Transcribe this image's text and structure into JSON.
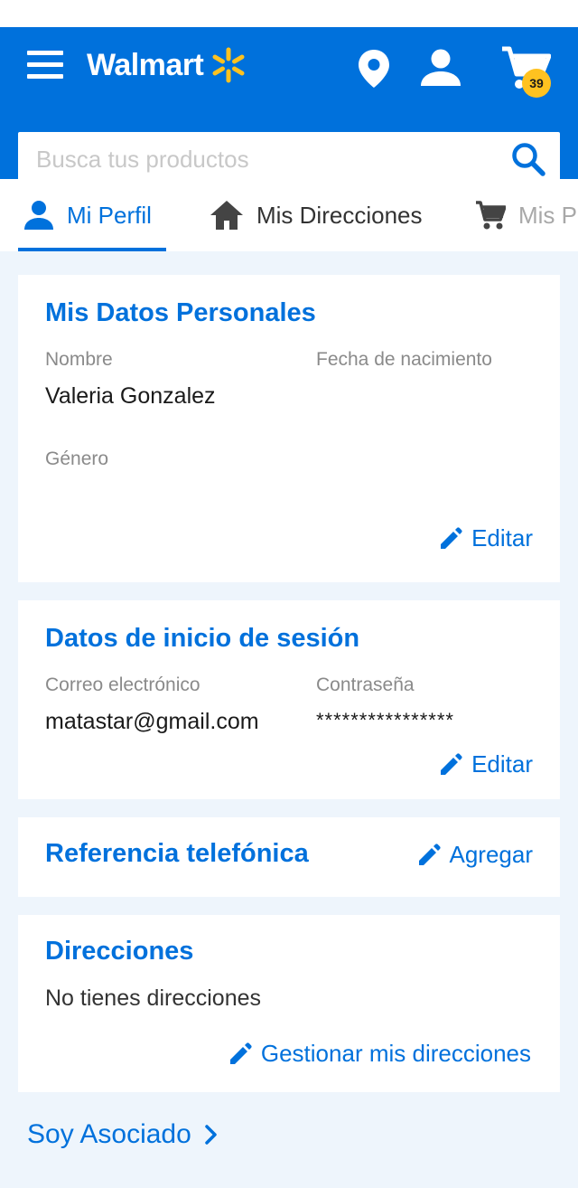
{
  "header": {
    "brand": "Walmart",
    "cart_count": "39",
    "brand_color": "#0071dc",
    "badge_color": "#ffc220"
  },
  "search": {
    "placeholder": "Busca tus productos",
    "value": ""
  },
  "tabs": [
    {
      "label": "Mi Perfil",
      "icon": "user-icon",
      "active": true
    },
    {
      "label": "Mis Direcciones",
      "icon": "home-icon",
      "active": false
    },
    {
      "label": "Mis P",
      "icon": "cart-icon",
      "active": false
    }
  ],
  "personal": {
    "title": "Mis Datos Personales",
    "name_label": "Nombre",
    "name_value": "Valeria Gonzalez",
    "birth_label": "Fecha de nacimiento",
    "birth_value": "",
    "gender_label": "Género",
    "gender_value": "",
    "edit_label": "Editar"
  },
  "login": {
    "title": "Datos de inicio de sesión",
    "email_label": "Correo electrónico",
    "email_value": "matastar@gmail.com",
    "password_label": "Contraseña",
    "password_value": "****************",
    "edit_label": "Editar"
  },
  "phone": {
    "title": "Referencia telefónica",
    "add_label": "Agregar"
  },
  "addresses": {
    "title": "Direcciones",
    "empty_text": "No tienes direcciones",
    "manage_label": "Gestionar mis direcciones"
  },
  "footer": {
    "associate_label": "Soy Asociado"
  }
}
